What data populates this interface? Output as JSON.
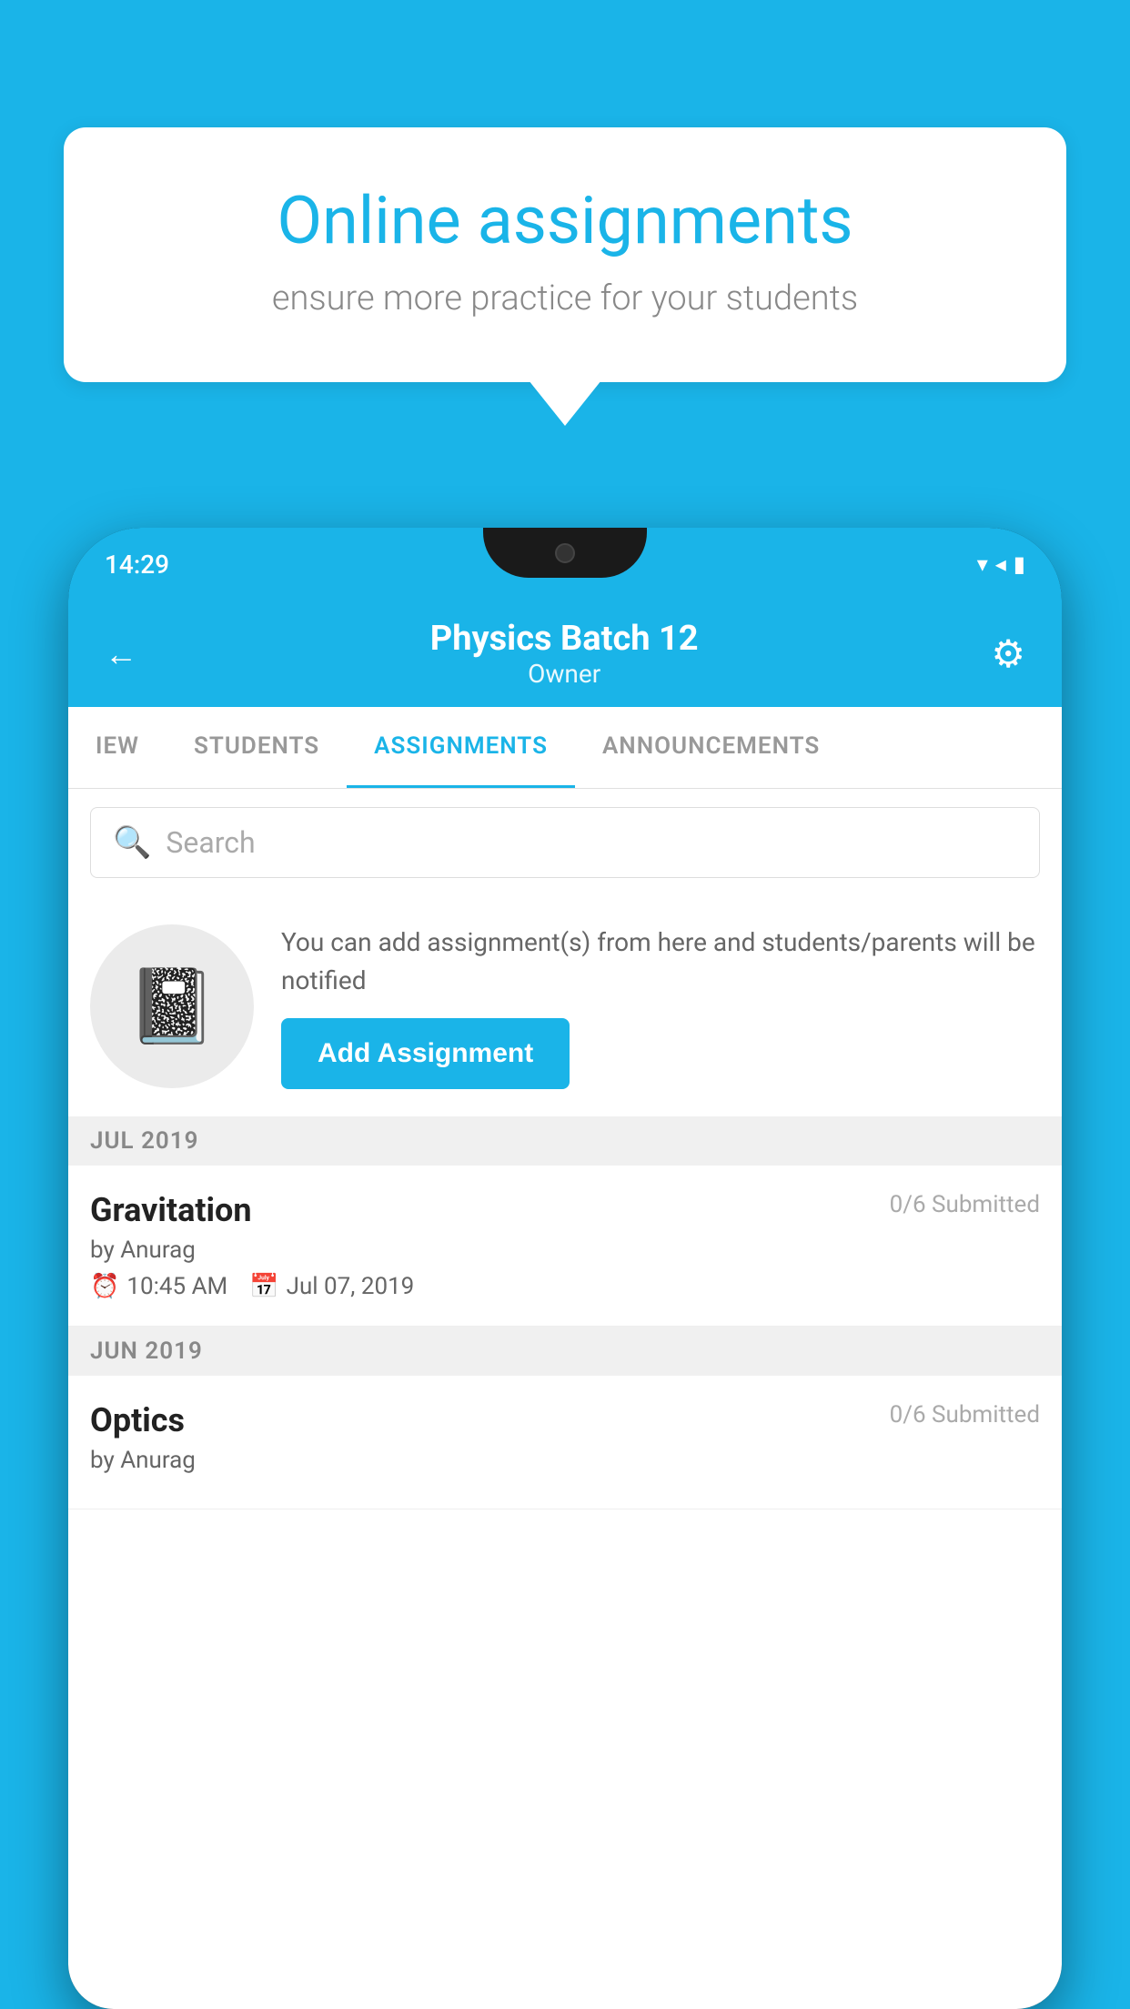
{
  "background_color": "#1ab4e8",
  "speech_bubble": {
    "title": "Online assignments",
    "subtitle": "ensure more practice for your students"
  },
  "phone": {
    "status_bar": {
      "time": "14:29",
      "wifi_icon": "▼",
      "signal_icon": "◀",
      "battery_icon": "▐"
    },
    "header": {
      "title": "Physics Batch 12",
      "subtitle": "Owner",
      "back_label": "←",
      "gear_label": "⚙"
    },
    "tabs": [
      {
        "label": "IEW",
        "active": false
      },
      {
        "label": "STUDENTS",
        "active": false
      },
      {
        "label": "ASSIGNMENTS",
        "active": true
      },
      {
        "label": "ANNOUNCEMENTS",
        "active": false
      }
    ],
    "search": {
      "placeholder": "Search"
    },
    "promo": {
      "text": "You can add assignment(s) from here and students/parents will be notified",
      "button_label": "Add Assignment"
    },
    "sections": [
      {
        "month": "JUL 2019",
        "assignments": [
          {
            "title": "Gravitation",
            "submitted": "0/6 Submitted",
            "by": "by Anurag",
            "time": "10:45 AM",
            "date": "Jul 07, 2019"
          }
        ]
      },
      {
        "month": "JUN 2019",
        "assignments": [
          {
            "title": "Optics",
            "submitted": "0/6 Submitted",
            "by": "by Anurag",
            "time": "",
            "date": ""
          }
        ]
      }
    ]
  }
}
